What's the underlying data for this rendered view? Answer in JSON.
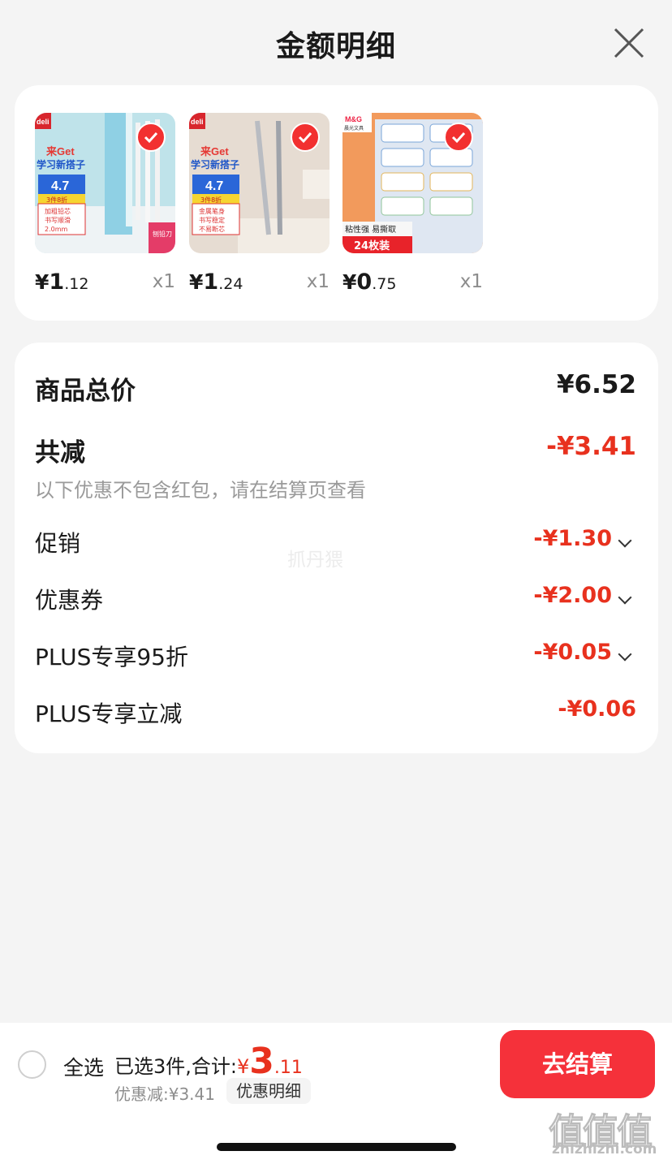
{
  "header": {
    "title": "金额明细"
  },
  "products": [
    {
      "name": "deli pencil",
      "price_int": "1",
      "price_dec": ".12",
      "currency": "¥",
      "qty": "x1",
      "thumb_texts": [
        "deli",
        "来Get",
        "学习新搭子",
        "4.7",
        "3件8折",
        "加粗铅芯",
        "书写顺滑",
        "2.0mm",
        "刨铅刀"
      ]
    },
    {
      "name": "deli mechanical pencil",
      "price_int": "1",
      "price_dec": ".24",
      "currency": "¥",
      "qty": "x1",
      "thumb_texts": [
        "deli",
        "来Get",
        "学习新搭子",
        "4.7",
        "3件8折",
        "金属笔身",
        "书写稳定",
        "不易断芯"
      ]
    },
    {
      "name": "M&G labels",
      "price_int": "0",
      "price_dec": ".75",
      "currency": "¥",
      "qty": "x1",
      "thumb_texts": [
        "M&G",
        "晨光文具",
        "粘性强 易撕取",
        "24枚装"
      ]
    }
  ],
  "summary": {
    "total_label": "商品总价",
    "total_value": "¥6.52",
    "reduce_label": "共减",
    "reduce_value": "-¥3.41",
    "hint": "以下优惠不包含红包，请在结算页查看",
    "items": [
      {
        "label": "促销",
        "value": "-¥1.30",
        "expandable": true
      },
      {
        "label": "优惠券",
        "value": "-¥2.00",
        "expandable": true
      },
      {
        "label": "PLUS专享95折",
        "value": "-¥0.05",
        "expandable": true
      },
      {
        "label": "PLUS专享立减",
        "value": "-¥0.06",
        "expandable": false
      }
    ],
    "watermark": "抓丹猥"
  },
  "bottom": {
    "select_all": "全选",
    "selected_text": "已选3件,合计:",
    "currency": "¥",
    "total_int": "3",
    "total_dec": ".11",
    "discount_text": "优惠减:¥3.41",
    "detail_link": "优惠明细",
    "checkout": "去结算"
  },
  "watermark_site": {
    "zh": "值值值",
    "en": "zhizhizhi.com"
  },
  "colors": {
    "accent_red": "#e8311e",
    "checkout_bg": "#f5313a",
    "card_bg": "#ffffff",
    "page_bg": "#f4f4f4"
  }
}
